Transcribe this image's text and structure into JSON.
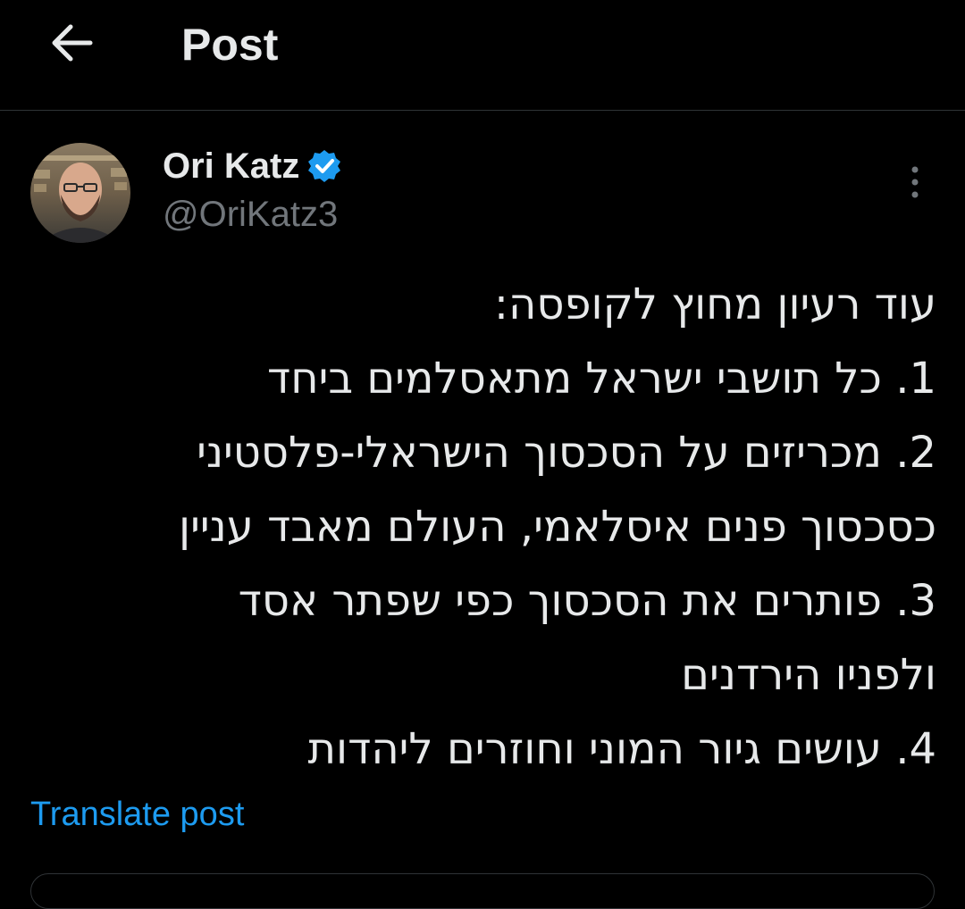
{
  "header": {
    "title": "Post",
    "back_icon": "arrow-left-icon"
  },
  "author": {
    "name": "Ori Katz",
    "handle": "@OriKatz3",
    "verified": true,
    "verified_icon": "verified-badge-icon",
    "verified_color": "#1d9bf0"
  },
  "post": {
    "lines": [
      "עוד רעיון מחוץ לקופסה:",
      "1. כל תושבי ישראל מתאסלמים ביחד",
      "2. מכריזים על הסכסוך הישראלי-פלסטיני",
      "כסכסוך פנים איסלאמי, העולם מאבד עניין",
      "3. פותרים את הסכסוך כפי שפתר אסד",
      "ולפניו הירדנים",
      "4. עושים גיור המוני וחוזרים ליהדות"
    ],
    "translate_label": "Translate post"
  },
  "colors": {
    "background": "#000000",
    "text": "#e7e9ea",
    "secondary_text": "#71767b",
    "accent": "#1d9bf0",
    "divider": "#2f3336"
  },
  "icons": {
    "more": "more-vertical-icon"
  }
}
